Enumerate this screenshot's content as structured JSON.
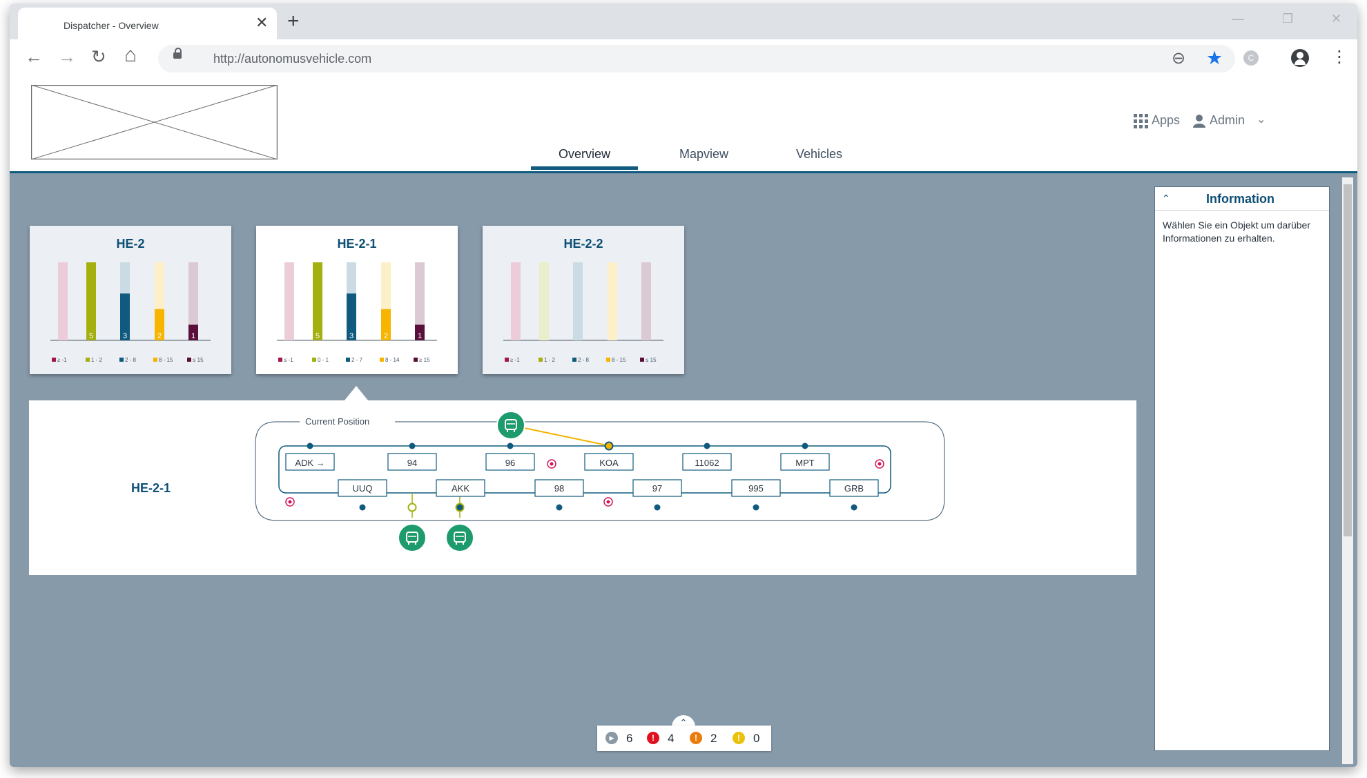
{
  "browser": {
    "tab_title": "Dispatcher - Overview",
    "tab_close": "✕",
    "new_tab": "+",
    "url": "http://autonomusvehicle.com",
    "extension_letter": "C",
    "controls": {
      "minimize": "—",
      "restore": "❐",
      "close": "✕"
    },
    "icons": {
      "back": "←",
      "forward": "→",
      "reload": "↻",
      "home": "⌂",
      "zoom": "⊖",
      "star": "★",
      "menu": "⋮"
    }
  },
  "header": {
    "apps_label": "Apps",
    "user_label": "Admin",
    "user_chevron": "⌄",
    "nav": [
      {
        "label": "Overview",
        "active": true
      },
      {
        "label": "Mapview",
        "active": false
      },
      {
        "label": "Vehicles",
        "active": false
      }
    ]
  },
  "cards": [
    {
      "title": "HE-2",
      "active": false,
      "bars": [
        {
          "value": 0,
          "label": "",
          "color": "#a3174f",
          "legend": "≥ -1"
        },
        {
          "value": 5,
          "label": "5",
          "color": "#a3b010",
          "legend": "1 - 2"
        },
        {
          "value": 3,
          "label": "3",
          "color": "#0f5a7e",
          "legend": "2 - 8"
        },
        {
          "value": 2,
          "label": "2",
          "color": "#f7b500",
          "legend": "8 - 15"
        },
        {
          "value": 1,
          "label": "1",
          "color": "#5a0f3a",
          "legend": "≤ 15"
        }
      ]
    },
    {
      "title": "HE-2-1",
      "active": true,
      "bars": [
        {
          "value": 0,
          "label": "",
          "color": "#a3174f",
          "legend": "≤ -1"
        },
        {
          "value": 5,
          "label": "5",
          "color": "#a3b010",
          "legend": "0 - 1"
        },
        {
          "value": 3,
          "label": "3",
          "color": "#0f5a7e",
          "legend": "2 - 7"
        },
        {
          "value": 2,
          "label": "2",
          "color": "#f7b500",
          "legend": "8 - 14"
        },
        {
          "value": 1,
          "label": "1",
          "color": "#5a0f3a",
          "legend": "≥ 15"
        }
      ]
    },
    {
      "title": "HE-2-2",
      "active": false,
      "bars": [
        {
          "value": 0,
          "label": "",
          "color": "#a3174f",
          "legend": "≥ -1"
        },
        {
          "value": 0,
          "label": "",
          "color": "#a3b010",
          "legend": "1 - 2"
        },
        {
          "value": 0,
          "label": "",
          "color": "#0f5a7e",
          "legend": "2 - 8"
        },
        {
          "value": 0,
          "label": "",
          "color": "#f7b500",
          "legend": "8 - 15"
        },
        {
          "value": 0,
          "label": "",
          "color": "#5a0f3a",
          "legend": "≤ 15"
        }
      ]
    }
  ],
  "detail": {
    "label": "HE-2-1",
    "current_position_label": "Current Position",
    "stations_top": [
      "ADK →",
      "94",
      "96",
      "KOA",
      "11062",
      "MPT"
    ],
    "stations_bottom": [
      "UUQ",
      "AKK",
      "98",
      "97",
      "995",
      "GRB"
    ]
  },
  "info_panel": {
    "title": "Information",
    "chevron": "⌃",
    "text": "Wählen Sie ein Objekt um darüber Informationen zu erhalten."
  },
  "status_bar": {
    "toggle": "⌃",
    "items": [
      {
        "icon": "play-icon",
        "symbol": "▶",
        "count": "6",
        "color": "#8b98a5"
      },
      {
        "icon": "error-icon",
        "symbol": "!",
        "count": "4",
        "color": "#e0111d"
      },
      {
        "icon": "warning-icon",
        "symbol": "!",
        "count": "2",
        "color": "#eb7c0c"
      },
      {
        "icon": "info-warning-icon",
        "symbol": "!",
        "count": "0",
        "color": "#ebc10c"
      }
    ]
  }
}
